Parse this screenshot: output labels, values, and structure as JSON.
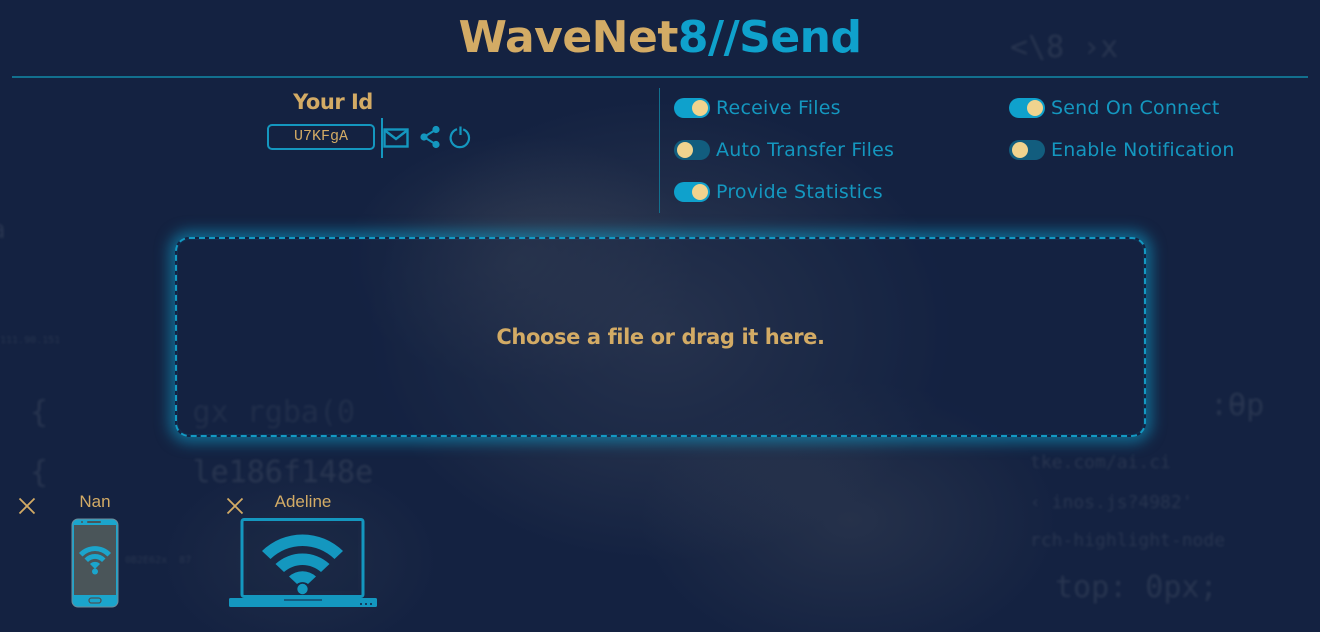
{
  "header": {
    "title_part1": "WaveNet",
    "title_part2": "8//Send"
  },
  "identity": {
    "label": "Your Id",
    "id_value": "U7KFgA",
    "actions": [
      {
        "name": "email",
        "icon": "mail-icon"
      },
      {
        "name": "share",
        "icon": "share-icon"
      },
      {
        "name": "refresh",
        "icon": "refresh-icon"
      }
    ]
  },
  "settings": {
    "left": [
      {
        "label": "Receive Files",
        "enabled": true
      },
      {
        "label": "Auto Transfer Files",
        "enabled": false
      },
      {
        "label": "Provide Statistics",
        "enabled": true
      }
    ],
    "right": [
      {
        "label": "Send On Connect",
        "enabled": true
      },
      {
        "label": "Enable Notification",
        "enabled": false
      }
    ]
  },
  "dropzone": {
    "text": "Choose a file or drag it here."
  },
  "devices": [
    {
      "name": "Nan",
      "type": "phone",
      "icon": "phone-wifi-icon"
    },
    {
      "name": "Adeline",
      "type": "laptop",
      "icon": "laptop-wifi-icon"
    }
  ],
  "colors": {
    "background": "#142241",
    "gold": "#d3ab65",
    "accent": "#0fa1cc",
    "toggle_on": "#0fa1cc",
    "toggle_off": "#125d7e",
    "knob": "#f0d38e"
  }
}
